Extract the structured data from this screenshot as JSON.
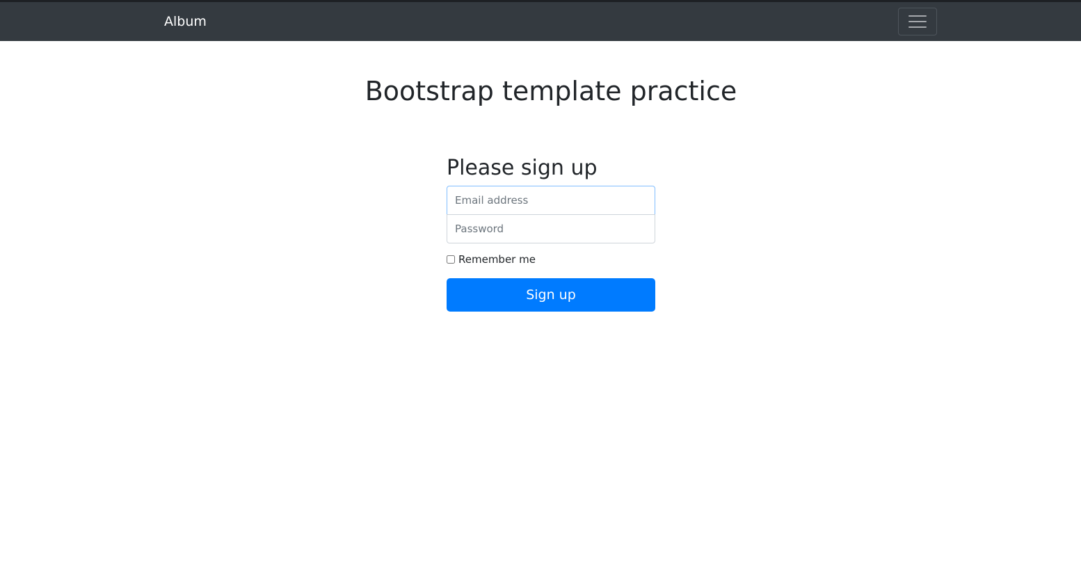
{
  "navbar": {
    "brand": "Album",
    "toggler_icon": "menu-hamburger-icon",
    "background": "#343a40"
  },
  "page": {
    "title": "Bootstrap template practice"
  },
  "signup_form": {
    "heading": "Please sign up",
    "email_placeholder": "Email address",
    "email_value": "",
    "password_placeholder": "Password",
    "password_value": "",
    "remember_label": "Remember me",
    "remember_checked": false,
    "submit_label": "Sign up",
    "accent_color": "#007bff"
  }
}
